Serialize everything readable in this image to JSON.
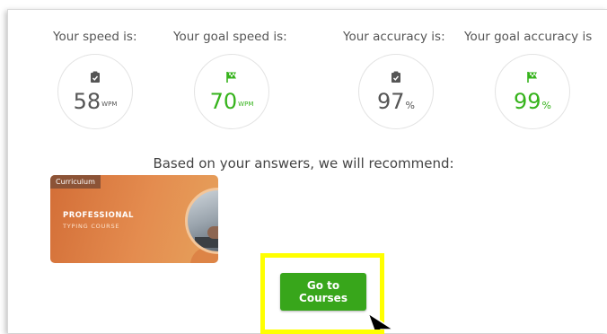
{
  "stats": [
    {
      "label": "Your speed is:",
      "value": "58",
      "unit": "WPM",
      "icon": "clipboard-check-icon",
      "highlight": false
    },
    {
      "label": "Your goal speed is:",
      "value": "70",
      "unit": "WPM",
      "icon": "checkered-flag-icon",
      "highlight": true
    },
    {
      "label": "Your accuracy is:",
      "value": "97",
      "unit": "%",
      "icon": "clipboard-check-icon",
      "highlight": false
    },
    {
      "label": "Your goal accuracy is",
      "value": "99",
      "unit": "%",
      "icon": "checkered-flag-icon",
      "highlight": true
    }
  ],
  "recommend_text": "Based on your answers, we will recommend:",
  "course_card": {
    "tag": "Curriculum",
    "title_line1": "PROFESSIONAL",
    "title_line2": "TYPING COURSE"
  },
  "cta_button": "Go to Courses",
  "colors": {
    "accent_green": "#36b31c",
    "button_green": "#38a61b",
    "highlight_yellow": "#ffff00",
    "card_orange": "#e48c4f"
  }
}
